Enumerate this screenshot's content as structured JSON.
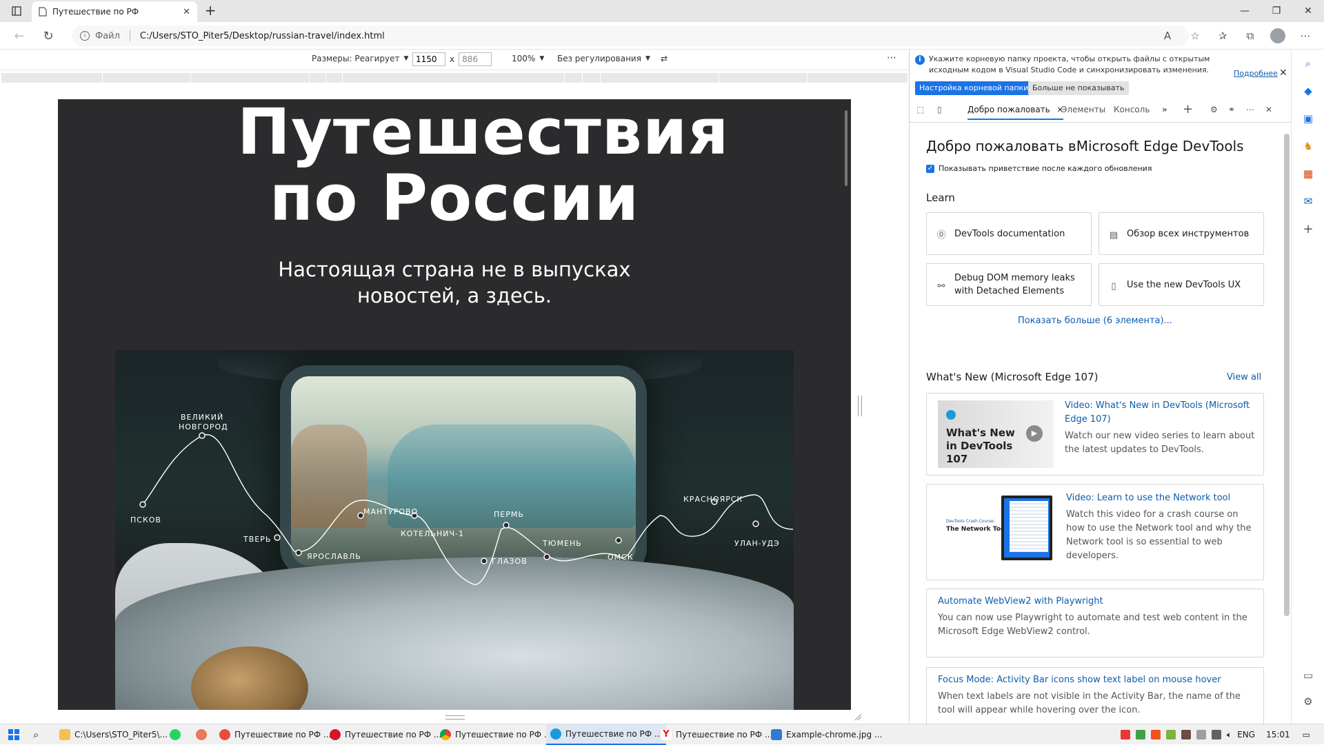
{
  "browser": {
    "tab_title": "Путешествие по РФ",
    "file_label": "Файл",
    "url": "C:/Users/STO_Piter5/Desktop/russian-travel/index.html"
  },
  "device_toolbar": {
    "dimensions_label": "Размеры: Реагирует",
    "width_value": "1150",
    "times": "x",
    "height_value": "886",
    "zoom": "100%",
    "throttle": "Без регулирования",
    "more": "⋯"
  },
  "page": {
    "title": "Путешествия по России",
    "subtitle": "Настоящая страна не в выпусках новостей, а здесь.",
    "route_cities": [
      "ПСКОВ",
      "ВЕЛИКИЙ",
      "НОВГОРОД",
      "ТВЕРЬ",
      "ЯРОСЛАВЛЬ",
      "МАНТУРОВО",
      "КОТЕЛЬНИЧ-1",
      "ГЛАЗОВ",
      "ПЕРМЬ",
      "ТЮМЕНЬ",
      "ОМСК",
      "КРАСНОЯРСК",
      "УЛАН-УДЭ"
    ]
  },
  "devtools": {
    "info_message": "Укажите корневую папку проекта, чтобы открыть файлы с открытым исходным кодом в Visual Studio Code и синхронизировать изменения.",
    "info_more": "Подробнее",
    "btn_root": "Настройка корневой папки",
    "btn_dismiss": "Больше не показывать",
    "tabs": {
      "welcome": "Добро пожаловать",
      "elements": "Элементы",
      "console": "Консоль"
    },
    "welcome_heading": "Добро пожаловать вMicrosoft Edge DevTools",
    "show_welcome_label": "Показывать приветствие после каждого обновления",
    "learn_heading": "Learn",
    "cards": [
      {
        "label": "DevTools documentation",
        "icon": "docs-icon"
      },
      {
        "label": "Обзор всех инструментов",
        "icon": "page-icon"
      },
      {
        "label": "Debug DOM memory leaks with Detached Elements",
        "icon": "link-icon"
      },
      {
        "label": "Use the new DevTools UX",
        "icon": "panel-icon"
      }
    ],
    "show_more": "Показать больше (6 элемента)...",
    "whats_new_heading": "What's New (Microsoft Edge 107)",
    "view_all": "View all",
    "news": [
      {
        "thumb_text": "What's New in DevTools 107",
        "title": "Video: What's New in DevTools (Microsoft Edge 107)",
        "body": "Watch our new video series to learn about the latest updates to DevTools."
      },
      {
        "thumb_caption": "DevTools Crash Course:",
        "thumb_text": "The Network Tool",
        "title": "Video: Learn to use the Network tool",
        "body": "Watch this video for a crash course on how to use the Network tool and why the Network tool is so essential to web developers."
      },
      {
        "title": "Automate WebView2 with Playwright",
        "body": "You can now use Playwright to automate and test web content in the Microsoft Edge WebView2 control."
      },
      {
        "title": "Focus Mode: Activity Bar icons show text label on mouse hover",
        "body": "When text labels are not visible in the Activity Bar, the name of the tool will appear while hovering over the icon."
      }
    ]
  },
  "taskbar": {
    "items": [
      {
        "label": "C:\\Users\\STO_Piter5\\...",
        "icon": "folder-icon",
        "color": "#f2c14e"
      },
      {
        "label": "Путешествие по РФ ...",
        "icon": "yandex-browser-icon",
        "color": "#e84c3d"
      },
      {
        "label": "Путешествие по РФ ...",
        "icon": "opera-icon",
        "color": "#d4162d"
      },
      {
        "label": "Путешествие по РФ ...",
        "icon": "chrome-icon",
        "color": "#4caf50"
      },
      {
        "label": "Путешествие по РФ ...",
        "icon": "edge-icon",
        "color": "#1a9bd7"
      },
      {
        "label": "Путешествие по РФ ...",
        "icon": "yandex-icon",
        "color": "#e11d1d"
      },
      {
        "label": "Example-chrome.jpg ...",
        "icon": "image-icon",
        "color": "#2f7bd3"
      }
    ],
    "lang": "ENG",
    "time": "15:01"
  }
}
